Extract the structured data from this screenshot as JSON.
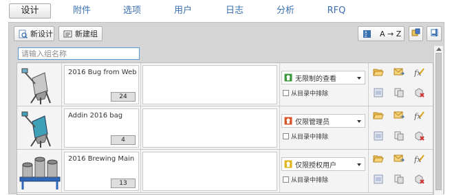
{
  "tabs": [
    {
      "label": "设计",
      "active": true
    },
    {
      "label": "附件"
    },
    {
      "label": "选项"
    },
    {
      "label": "用户"
    },
    {
      "label": "日志"
    },
    {
      "label": "分析"
    },
    {
      "label": "RFQ"
    }
  ],
  "toolbar": {
    "new_design": "新设计",
    "new_group": "新建组",
    "sort": "A → Z",
    "icon_new_design": "new-design-icon",
    "icon_new_group": "new-group-icon",
    "icon_sort": "sort-alpha-icon",
    "icon_settings": "list-settings-icon",
    "icon_help": "help-icon"
  },
  "search": {
    "placeholder": "请输入组名称"
  },
  "rows": [
    {
      "name": "2016 Bug from Web",
      "count": "24",
      "permission": "无限制的查看",
      "perm_color": "#3c9a3c",
      "exclude_label": "从目录中排除"
    },
    {
      "name": "Addin 2016 bag",
      "count": "4",
      "permission": "仅限管理员",
      "perm_color": "#d9532b",
      "exclude_label": "从目录中排除"
    },
    {
      "name": "2016 Brewing Main",
      "count": "13",
      "permission": "仅限授权用户",
      "perm_color": "#e1b51c",
      "exclude_label": "从目录中排除"
    }
  ],
  "colors": {
    "tab_text": "#3a6fb0",
    "panel_bg": "#d5d5d5",
    "focus_border": "#5b9bd5"
  }
}
